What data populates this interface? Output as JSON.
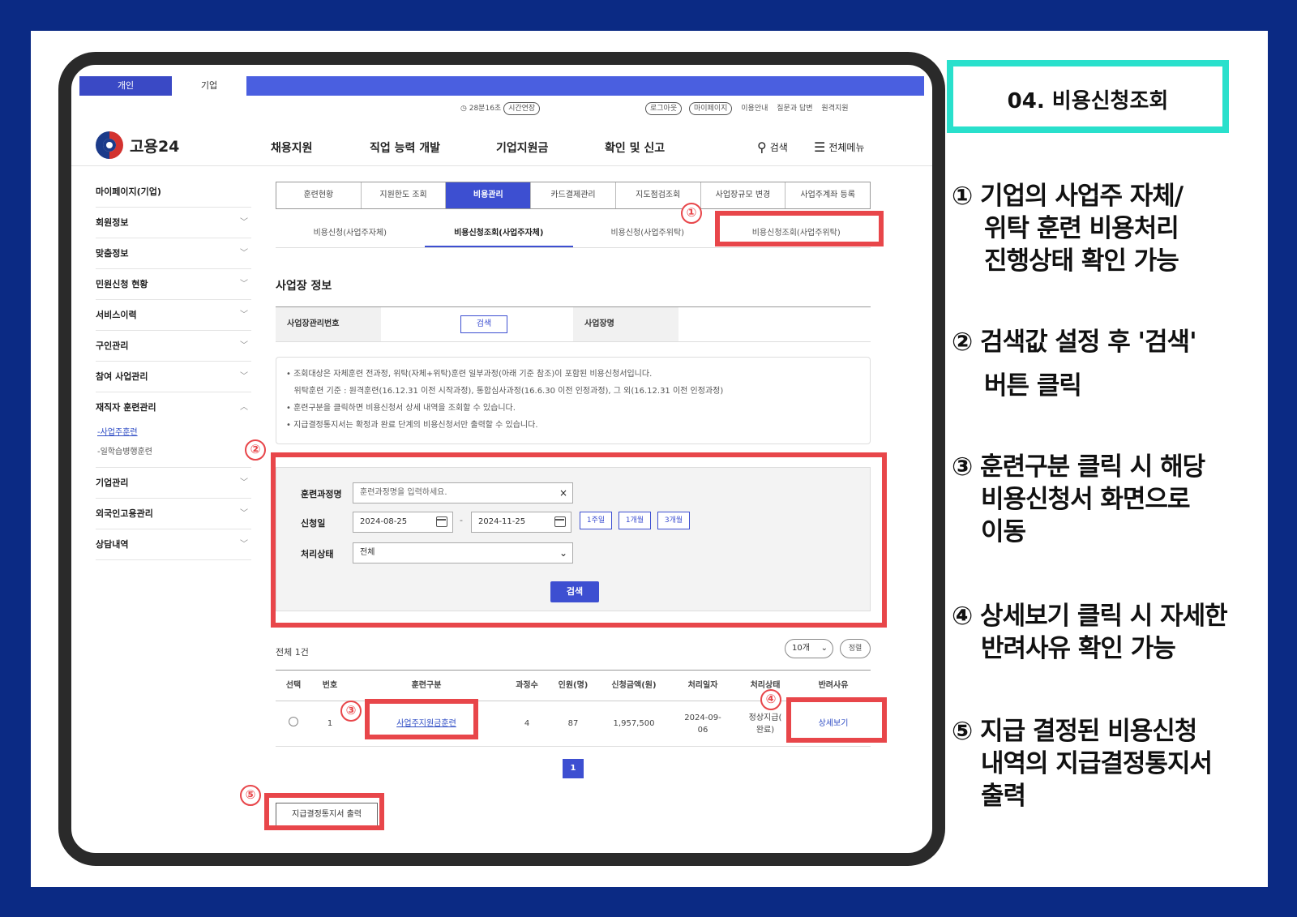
{
  "slide_title": "04. 비용신청조회",
  "top": {
    "member_tabs": [
      "개인",
      "기업"
    ],
    "session": "28분16초",
    "extend": "시간연장",
    "logout": "로그아웃",
    "mypage": "마이페이지",
    "links": [
      "이용안내",
      "질문과 답변",
      "원격지원"
    ]
  },
  "brand": {
    "name": "고용24"
  },
  "gnb": [
    "채용지원",
    "직업 능력 개발",
    "기업지원금",
    "확인 및 신고"
  ],
  "search_label": "검색",
  "allmenu_label": "전체메뉴",
  "sidebar": {
    "title": "마이페이지(기업)",
    "items": [
      "회원정보",
      "맞춤정보",
      "민원신청 현황",
      "서비스이력",
      "구인관리",
      "참여 사업관리",
      "재직자 훈련관리"
    ],
    "subitems": [
      "-사업주훈련",
      "-일학습병행훈련"
    ],
    "items2": [
      "기업관리",
      "외국인고용관리",
      "상담내역"
    ]
  },
  "tabs_main": [
    "훈련현황",
    "지원한도 조회",
    "비용관리",
    "카드결제관리",
    "지도점검조회",
    "사업장규모 변경",
    "사업주계좌 등록"
  ],
  "tabs_sub": [
    "비용신청(사업주자체)",
    "비용신청조회(사업주자체)",
    "비용신청(사업주위탁)",
    "비용신청조회(사업주위탁)"
  ],
  "section_title": "사업장 정보",
  "info": {
    "label1": "사업장관리번호",
    "search_btn": "검색",
    "label2": "사업장명"
  },
  "notices": [
    "• 조회대상은 자체훈련 전과정, 위탁(자체+위탁)훈련 일부과정(아래 기준 참조)이 포함된 비용신청서입니다.",
    "   위탁훈련 기준 : 원격훈련(16.12.31 이전 시작과정), 통합심사과정(16.6.30 이전 인정과정), 그 외(16.12.31 이전 인정과정)",
    "• 훈련구분을 클릭하면 비용신청서 상세 내역을 조회할 수 있습니다.",
    "• 지급결정통지서는 확정과 완료 단계의 비용신청서만 출력할 수 있습니다."
  ],
  "form": {
    "course_label": "훈련과정명",
    "course_placeholder": "훈련과정명을 입력하세요.",
    "date_label": "신청일",
    "date_from": "2024-08-25",
    "date_sep": "-",
    "date_to": "2024-11-25",
    "period_buttons": [
      "1주일",
      "1개월",
      "3개월"
    ],
    "status_label": "처리상태",
    "status_value": "전체",
    "search_button": "검색"
  },
  "results": {
    "total": "전체 1건",
    "page_size": "10개",
    "sort": "정렬",
    "headers": [
      "선택",
      "번호",
      "훈련구분",
      "과정수",
      "인원(명)",
      "신청금액(원)",
      "처리일자",
      "처리상태",
      "반려사유"
    ],
    "row": {
      "no": "1",
      "type": "사업주지원금훈련",
      "courses": "4",
      "people": "87",
      "amount": "1,957,500",
      "date_1": "2024-09-",
      "date_2": "06",
      "status_1": "정상지급(",
      "status_2": "완료)",
      "reason": "상세보기"
    },
    "page": "1",
    "print_button": "지급결정통지서 출력"
  },
  "markers": [
    "①",
    "②",
    "③",
    "④",
    "⑤"
  ],
  "notes": [
    {
      "num": "①",
      "lines": [
        "기업의 사업주 자체/",
        "위탁 훈련 비용처리",
        "진행상태 확인 가능"
      ]
    },
    {
      "num": "②",
      "lines": [
        "검색값 설정 후 '검색'",
        "버튼 클릭"
      ]
    },
    {
      "num": "③",
      "lines": [
        "훈련구분 클릭 시 해당",
        "비용신청서 화면으로",
        "이동"
      ]
    },
    {
      "num": "④",
      "lines": [
        "상세보기 클릭 시 자세한",
        "반려사유 확인 가능"
      ]
    },
    {
      "num": "⑤",
      "lines": [
        "지급 결정된 비용신청",
        "내역의 지급결정통지서",
        "출력"
      ]
    }
  ],
  "colors": {
    "background": "#0b2a84",
    "accent": "#3d4fd1",
    "annotation": "#e8464a",
    "title_border": "#29e0cc"
  }
}
